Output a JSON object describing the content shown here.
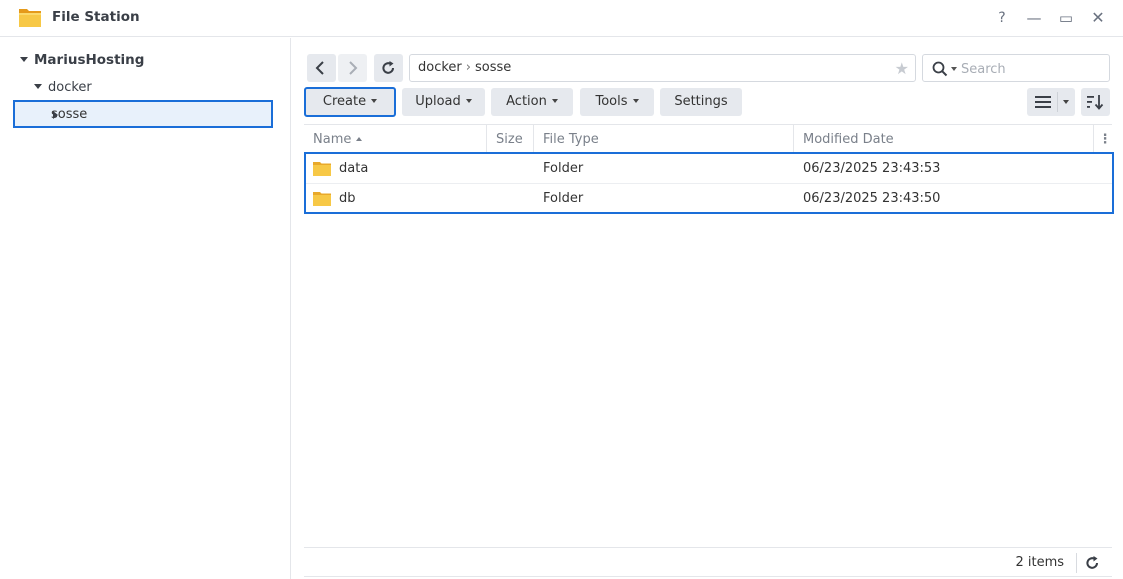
{
  "window": {
    "title": "File Station",
    "controls": {
      "help": "?",
      "minimize": "—",
      "maximize": "▭",
      "close": "✕"
    }
  },
  "sidebar": {
    "root": "MariusHosting",
    "folders": [
      {
        "label": "docker"
      },
      {
        "label": "sosse",
        "selected": true
      }
    ]
  },
  "path": {
    "segments": [
      "docker",
      "sosse"
    ],
    "separator": "›"
  },
  "search": {
    "placeholder": "Search"
  },
  "toolbar": {
    "create": "Create",
    "upload": "Upload",
    "action": "Action",
    "tools": "Tools",
    "settings": "Settings"
  },
  "table": {
    "columns": {
      "name": "Name",
      "size": "Size",
      "type": "File Type",
      "date": "Modified Date",
      "more": "⋮"
    },
    "rows": [
      {
        "name": "data",
        "size": "",
        "type": "Folder",
        "date": "06/23/2025 23:43:53"
      },
      {
        "name": "db",
        "size": "",
        "type": "Folder",
        "date": "06/23/2025 23:43:50"
      }
    ]
  },
  "footer": {
    "count": "2 items"
  },
  "colors": {
    "accent": "#1a6ed8",
    "folder": "#f5c242",
    "selected_bg": "#e8f1fb"
  },
  "icons": {
    "app": "file-station-folder-icon",
    "star": "star-icon",
    "search": "search-icon",
    "refresh": "refresh-icon"
  }
}
